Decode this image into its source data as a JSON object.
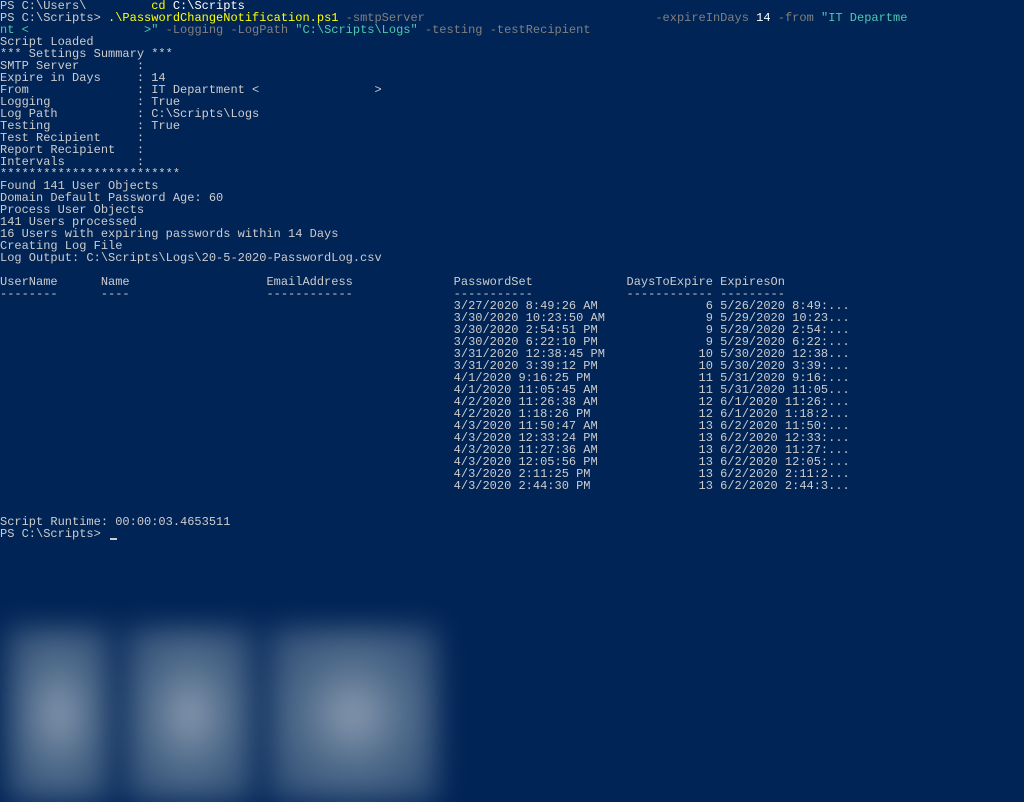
{
  "cmd1": {
    "prompt": "PS C:\\Users\\",
    "cmd_cd": "cd",
    "cmd_path": "C:\\Scripts"
  },
  "cmd2": {
    "prompt": "PS C:\\Scripts> ",
    "script": ".\\PasswordChangeNotification.ps1",
    "p_smtp": "-smtpServer ",
    "p_expire": "-expireInDays ",
    "v_expire": "14 ",
    "p_from": "-from ",
    "v_from_a": "\"IT Departme"
  },
  "cmd3": {
    "cont": "nt <",
    "close": ">\" ",
    "p_logging": "-Logging ",
    "p_logpath": "-LogPath ",
    "v_logpath": "\"C:\\Scripts\\Logs\" ",
    "p_testing": "-testing ",
    "p_testrcpt": "-testRecipient "
  },
  "out": {
    "l1": "Script Loaded",
    "l2": "*** Settings Summary ***",
    "l3a": "SMTP Server        : ",
    "l4": "Expire in Days     : 14",
    "l5a": "From               : IT Department < ",
    "l5b": ">",
    "l6": "Logging            : True",
    "l7": "Log Path           : C:\\Scripts\\Logs",
    "l8": "Testing            : True",
    "l9": "Test Recipient     : ",
    "l10": "Report Recipient   :",
    "l11": "Intervals          :",
    "l12": "*************************",
    "l13": "Found 141 User Objects",
    "l14": "Domain Default Password Age: 60",
    "l15": "Process User Objects",
    "l16": "141 Users processed",
    "l17": "16 Users with expiring passwords within 14 Days",
    "l18": "Creating Log File",
    "l19": "Log Output: C:\\Scripts\\Logs\\20-5-2020-PasswordLog.csv"
  },
  "tbl": {
    "header": "UserName      Name                   EmailAddress              PasswordSet             DaysToExpire ExpiresOn",
    "underline": "--------      ----                   ------------              -----------             ------------ ---------",
    "rows": [
      "                                                               3/27/2020 8:49:26 AM               6 5/26/2020 8:49:...",
      "                                                               3/30/2020 10:23:50 AM              9 5/29/2020 10:23...",
      "                                                               3/30/2020 2:54:51 PM               9 5/29/2020 2:54:...",
      "                                                               3/30/2020 6:22:10 PM               9 5/29/2020 6:22:...",
      "                                                               3/31/2020 12:38:45 PM             10 5/30/2020 12:38...",
      "                                                               3/31/2020 3:39:12 PM              10 5/30/2020 3:39:...",
      "                                                               4/1/2020 9:16:25 PM               11 5/31/2020 9:16:...",
      "                                                               4/1/2020 11:05:45 AM              11 5/31/2020 11:05...",
      "                                                               4/2/2020 11:26:38 AM              12 6/1/2020 11:26:...",
      "                                                               4/2/2020 1:18:26 PM               12 6/1/2020 1:18:2...",
      "                                                               4/3/2020 11:50:47 AM              13 6/2/2020 11:50:...",
      "                                                               4/3/2020 12:33:24 PM              13 6/2/2020 12:33:...",
      "                                                               4/3/2020 11:27:36 AM              13 6/2/2020 11:27:...",
      "                                                               4/3/2020 12:05:56 PM              13 6/2/2020 12:05:...",
      "                                                               4/3/2020 2:11:25 PM               13 6/2/2020 2:11:2...",
      "                                                               4/3/2020 2:44:30 PM               13 6/2/2020 2:44:3..."
    ]
  },
  "footer": {
    "runtime": "Script Runtime: 00:00:03.4653511",
    "prompt": "PS C:\\Scripts> "
  }
}
